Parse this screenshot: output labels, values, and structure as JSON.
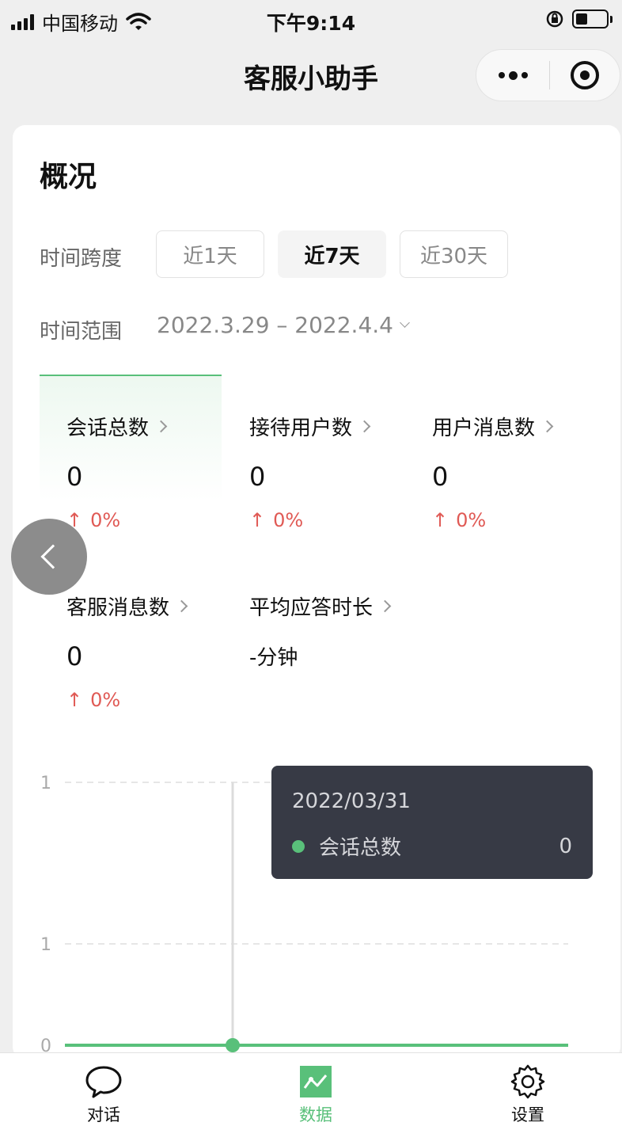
{
  "status_bar": {
    "carrier": "中国移动",
    "time": "下午9:14"
  },
  "nav": {
    "title": "客服小助手",
    "more_icon": "more-dots-icon",
    "close_icon": "target-circle-icon"
  },
  "overview": {
    "title": "概况",
    "time_span_label": "时间跨度",
    "time_span_options": [
      "近1天",
      "近7天",
      "近30天"
    ],
    "selected_time_span": "近7天",
    "time_range_label": "时间范围",
    "time_range_value": "2022.3.29 – 2022.4.4",
    "metrics": [
      {
        "label": "会话总数",
        "value": "0",
        "change": "0%",
        "selected": true
      },
      {
        "label": "接待用户数",
        "value": "0",
        "change": "0%"
      },
      {
        "label": "用户消息数",
        "value": "0",
        "change": "0%"
      },
      {
        "label": "客服消息数",
        "value": "0",
        "change": "0%"
      },
      {
        "label": "平均应答时长",
        "value": "-分钟"
      }
    ],
    "change_arrow": "↑"
  },
  "chart_data": {
    "type": "line",
    "series": [
      {
        "name": "会话总数",
        "values": [
          0,
          0,
          0,
          0,
          0,
          0,
          0
        ]
      }
    ],
    "y_tick_labels": [
      "1",
      "1",
      "0"
    ],
    "ylim": [
      0,
      1
    ],
    "grid": true,
    "highlighted_index": 2,
    "tooltip": {
      "date": "2022/03/31",
      "series_name": "会话总数",
      "value": "0"
    },
    "colors": {
      "line": "#59c07a"
    }
  },
  "tabbar": {
    "items": [
      {
        "label": "对话",
        "icon": "chat-bubble-icon"
      },
      {
        "label": "数据",
        "icon": "data-chart-icon",
        "active": true
      },
      {
        "label": "设置",
        "icon": "gear-icon"
      }
    ]
  },
  "colors": {
    "accent": "#59c07a",
    "increase": "#e05a55",
    "tooltip_bg": "#373a45"
  }
}
